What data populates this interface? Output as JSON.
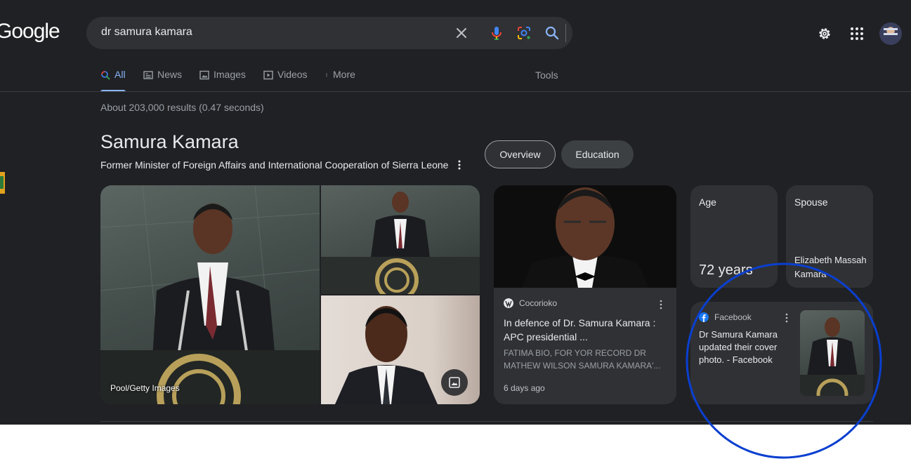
{
  "logo": {
    "text": "Google"
  },
  "search": {
    "query": "dr samura kamara",
    "icons": [
      "close-icon",
      "microphone-icon",
      "lens-icon",
      "search-icon"
    ]
  },
  "header": {
    "icons": [
      "gear-icon",
      "apps-grid-icon",
      "avatar"
    ]
  },
  "tabs": [
    {
      "label": "All",
      "icon": "search-icon",
      "active": true
    },
    {
      "label": "News",
      "icon": "news-icon"
    },
    {
      "label": "Images",
      "icon": "image-icon"
    },
    {
      "label": "Videos",
      "icon": "play-icon"
    },
    {
      "label": "More",
      "icon": "more-vert-icon"
    }
  ],
  "tools_label": "Tools",
  "results_count": "About 203,000 results (0.47 seconds)",
  "knowledge_panel": {
    "title": "Samura Kamara",
    "subtitle": "Former Minister of Foreign Affairs and International Cooperation of Sierra Leone",
    "chips": [
      "Overview",
      "Education"
    ],
    "image_credit": "Pool/Getty Images",
    "news_card": {
      "source": "Cocorioko",
      "title": "In defence of Dr. Samura Kamara : APC presidential ...",
      "snippet": "FATIMA BIO, FOR YOR RECORD DR MATHEW WILSON SAMURA KAMARA'...",
      "time": "6 days ago"
    },
    "age": {
      "label": "Age",
      "value": "72 years"
    },
    "spouse": {
      "label": "Spouse",
      "value": "Elizabeth Massah Kamara"
    },
    "facebook_card": {
      "source": "Facebook",
      "text": "Dr Samura Kamara updated their cover photo. - Facebook"
    }
  },
  "colors": {
    "background": "#202124",
    "surface": "#303134",
    "accent": "#8ab4f8",
    "annotation_circle": "#0a3fd0"
  }
}
